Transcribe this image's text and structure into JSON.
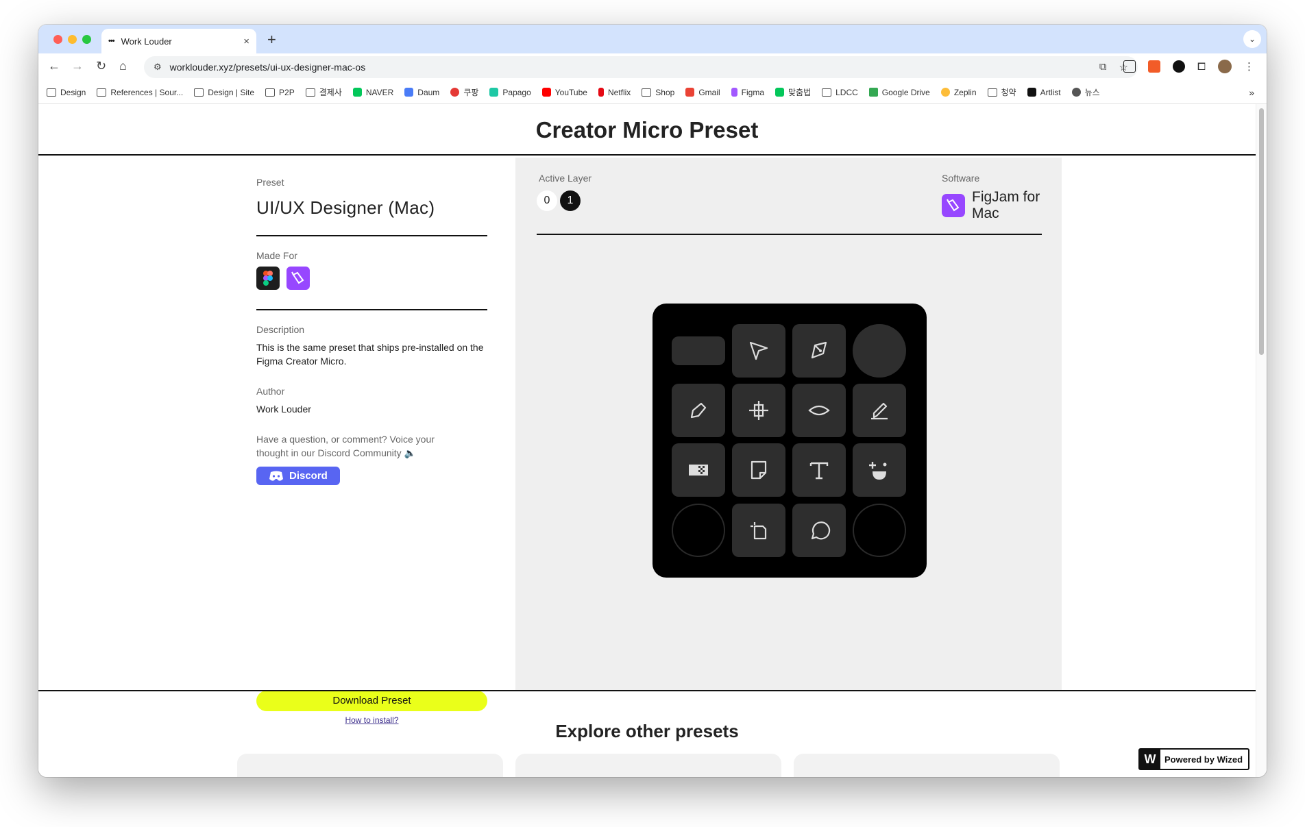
{
  "browser": {
    "tab_title": "Work Louder",
    "new_tab": "+",
    "tab_close": "×",
    "url": "worklouder.xyz/presets/ui-ux-designer-mac-os",
    "bookmarks": [
      "Design",
      "References | Sour...",
      "Design | Site",
      "P2P",
      "결제사",
      "NAVER",
      "Daum",
      "쿠팡",
      "Papago",
      "YouTube",
      "Netflix",
      "Shop",
      "Gmail",
      "Figma",
      "맞춤법",
      "LDCC",
      "Google Drive",
      "Zeplin",
      "청약",
      "Artlist",
      "뉴스"
    ],
    "bookmarks_more": "»"
  },
  "page": {
    "title": "Creator Micro Preset",
    "preset_label": "Preset",
    "preset_name": "UI/UX Designer (Mac)",
    "made_for_label": "Made For",
    "description_label": "Description",
    "description": "This is the same preset that ships pre-installed on the Figma Creator Micro.",
    "author_label": "Author",
    "author": "Work Louder",
    "question": "Have a question, or comment? Voice your thought in our Discord Community 🔈",
    "discord_label": "Discord",
    "download_label": "Download Preset",
    "install_link": "How to install?",
    "active_layer_label": "Active Layer",
    "layers": [
      "0",
      "1"
    ],
    "active_layer": "1",
    "software_label": "Software",
    "software": "FigJam for Mac",
    "explore_title": "Explore other presets",
    "wized_label": "Powered by Wized",
    "wized_mark": "W"
  },
  "colors": {
    "accent_yellow": "#eaff1a",
    "discord_blue": "#5865f2",
    "figjam_purple": "#9747ff",
    "panel_gray": "#efefef"
  },
  "keypad": {
    "rows": [
      [
        "blank",
        "move-tool-icon",
        "pen-tool-icon",
        "knob"
      ],
      [
        "pen-icon",
        "frame-resize-icon",
        "eye-icon",
        "marker-icon"
      ],
      [
        "washi-tape-icon",
        "sticky-note-icon",
        "text-icon",
        "emoji-icon"
      ],
      [
        "empty",
        "section-icon",
        "comment-icon",
        "empty"
      ]
    ]
  }
}
